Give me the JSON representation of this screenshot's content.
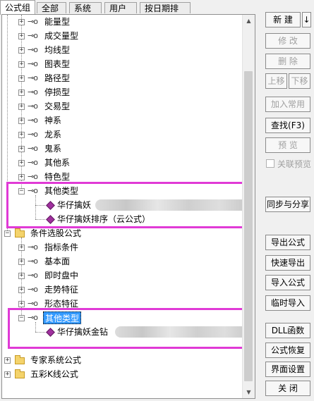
{
  "tabs": [
    "公式组",
    "全部",
    "系统",
    "用户",
    "按日期排序"
  ],
  "tree": {
    "items_top": [
      "能量型",
      "成交量型",
      "均线型",
      "图表型",
      "路径型",
      "停损型",
      "交易型",
      "神系",
      "龙系",
      "鬼系",
      "其他系",
      "特色型"
    ],
    "group1": {
      "label": "其他类型",
      "children": [
        "华仔擒妖",
        "华仔擒妖排序（云公式）"
      ]
    },
    "folder_condition": "条件选股公式",
    "items_condition": [
      "指标条件",
      "基本面",
      "即时盘中",
      "走势特征",
      "形态特征"
    ],
    "group2": {
      "label": "其他类型",
      "children": [
        "华仔擒妖金钻"
      ]
    },
    "folder_expert": "专家系统公式",
    "folder_kline": "五彩K线公式"
  },
  "buttons": {
    "new": "新 建",
    "new_arrow": "↓",
    "modify": "修 改",
    "delete": "删 除",
    "move_up": "上移",
    "move_down": "下移",
    "add_common": "加入常用",
    "find": "查找(F3)",
    "preview": "预 览",
    "linked_preview": "关联预览",
    "sync_share": "同步与分享",
    "export": "导出公式",
    "quick_export": "快速导出",
    "import": "导入公式",
    "temp_import": "临时导入",
    "dll": "DLL函数",
    "restore": "公式恢复",
    "ui_settings": "界面设置",
    "close": "关 闭"
  },
  "colors": {
    "highlight_border": "#e03ad6",
    "selected_bg": "#3399ff",
    "formula_icon": "#a0309e",
    "folder": "#f4d36b"
  }
}
